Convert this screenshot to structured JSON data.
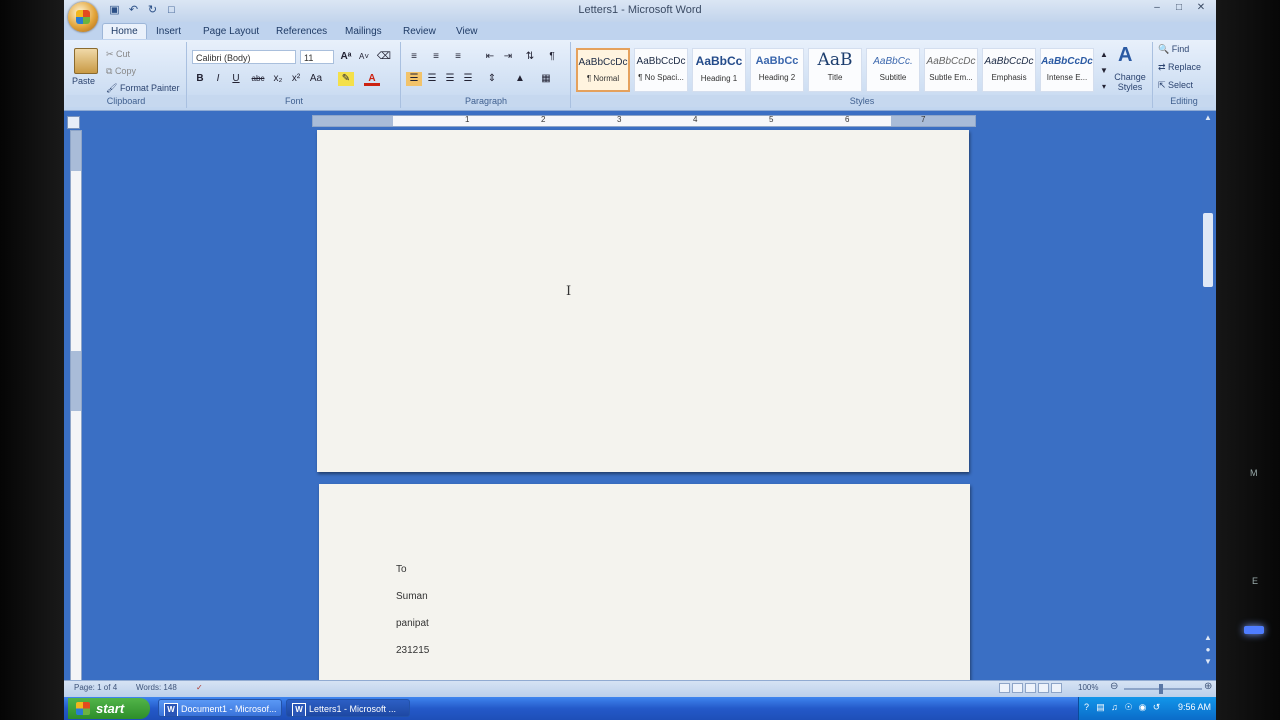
{
  "window": {
    "title": "Letters1 - Microsoft Word",
    "controls": [
      "minimize-icon",
      "maximize-icon",
      "close-icon"
    ]
  },
  "quick_access": [
    "save-icon",
    "undo-icon",
    "redo-icon",
    "new-document-icon"
  ],
  "tabs": [
    {
      "label": "Home",
      "active": true
    },
    {
      "label": "Insert"
    },
    {
      "label": "Page Layout"
    },
    {
      "label": "References"
    },
    {
      "label": "Mailings"
    },
    {
      "label": "Review"
    },
    {
      "label": "View"
    }
  ],
  "ribbon": {
    "clipboard": {
      "label": "Clipboard",
      "paste": "Paste",
      "cut": "Cut",
      "copy": "Copy",
      "format_painter": "Format Painter"
    },
    "font": {
      "label": "Font",
      "family": "Calibri (Body)",
      "size": "11",
      "buttons": [
        "B",
        "I",
        "U",
        "abc",
        "x₂",
        "x²",
        "Aa"
      ]
    },
    "paragraph": {
      "label": "Paragraph"
    },
    "styles": {
      "label": "Styles",
      "items": [
        {
          "sample": "AaBbCcDc",
          "name": "¶ Normal",
          "selected": true
        },
        {
          "sample": "AaBbCcDc",
          "name": "¶ No Spaci..."
        },
        {
          "sample": "AaBbCc",
          "name": "Heading 1"
        },
        {
          "sample": "AaBbCc",
          "name": "Heading 2"
        },
        {
          "sample": "AaB",
          "name": "Title"
        },
        {
          "sample": "AaBbCc.",
          "name": "Subtitle"
        },
        {
          "sample": "AaBbCcDc",
          "name": "Subtle Em..."
        },
        {
          "sample": "AaBbCcDc",
          "name": "Emphasis"
        },
        {
          "sample": "AaBbCcDc",
          "name": "Intense E..."
        }
      ],
      "change_styles": "Change Styles"
    },
    "editing": {
      "label": "Editing",
      "find": "Find",
      "replace": "Replace",
      "select": "Select"
    }
  },
  "ruler_numbers": [
    "1",
    "2",
    "3",
    "4",
    "5",
    "6",
    "7"
  ],
  "document": {
    "page2_lines": [
      "To",
      "Suman",
      "panipat",
      "231215"
    ]
  },
  "statusbar": {
    "page": "Page: 1 of 4",
    "words": "Words: 148",
    "zoom": "100%"
  },
  "taskbar": {
    "start": "start",
    "tasks": [
      {
        "label": "Document1 - Microsof..."
      },
      {
        "label": "Letters1 - Microsoft ...",
        "active": true
      }
    ],
    "clock": "9:56 AM"
  }
}
